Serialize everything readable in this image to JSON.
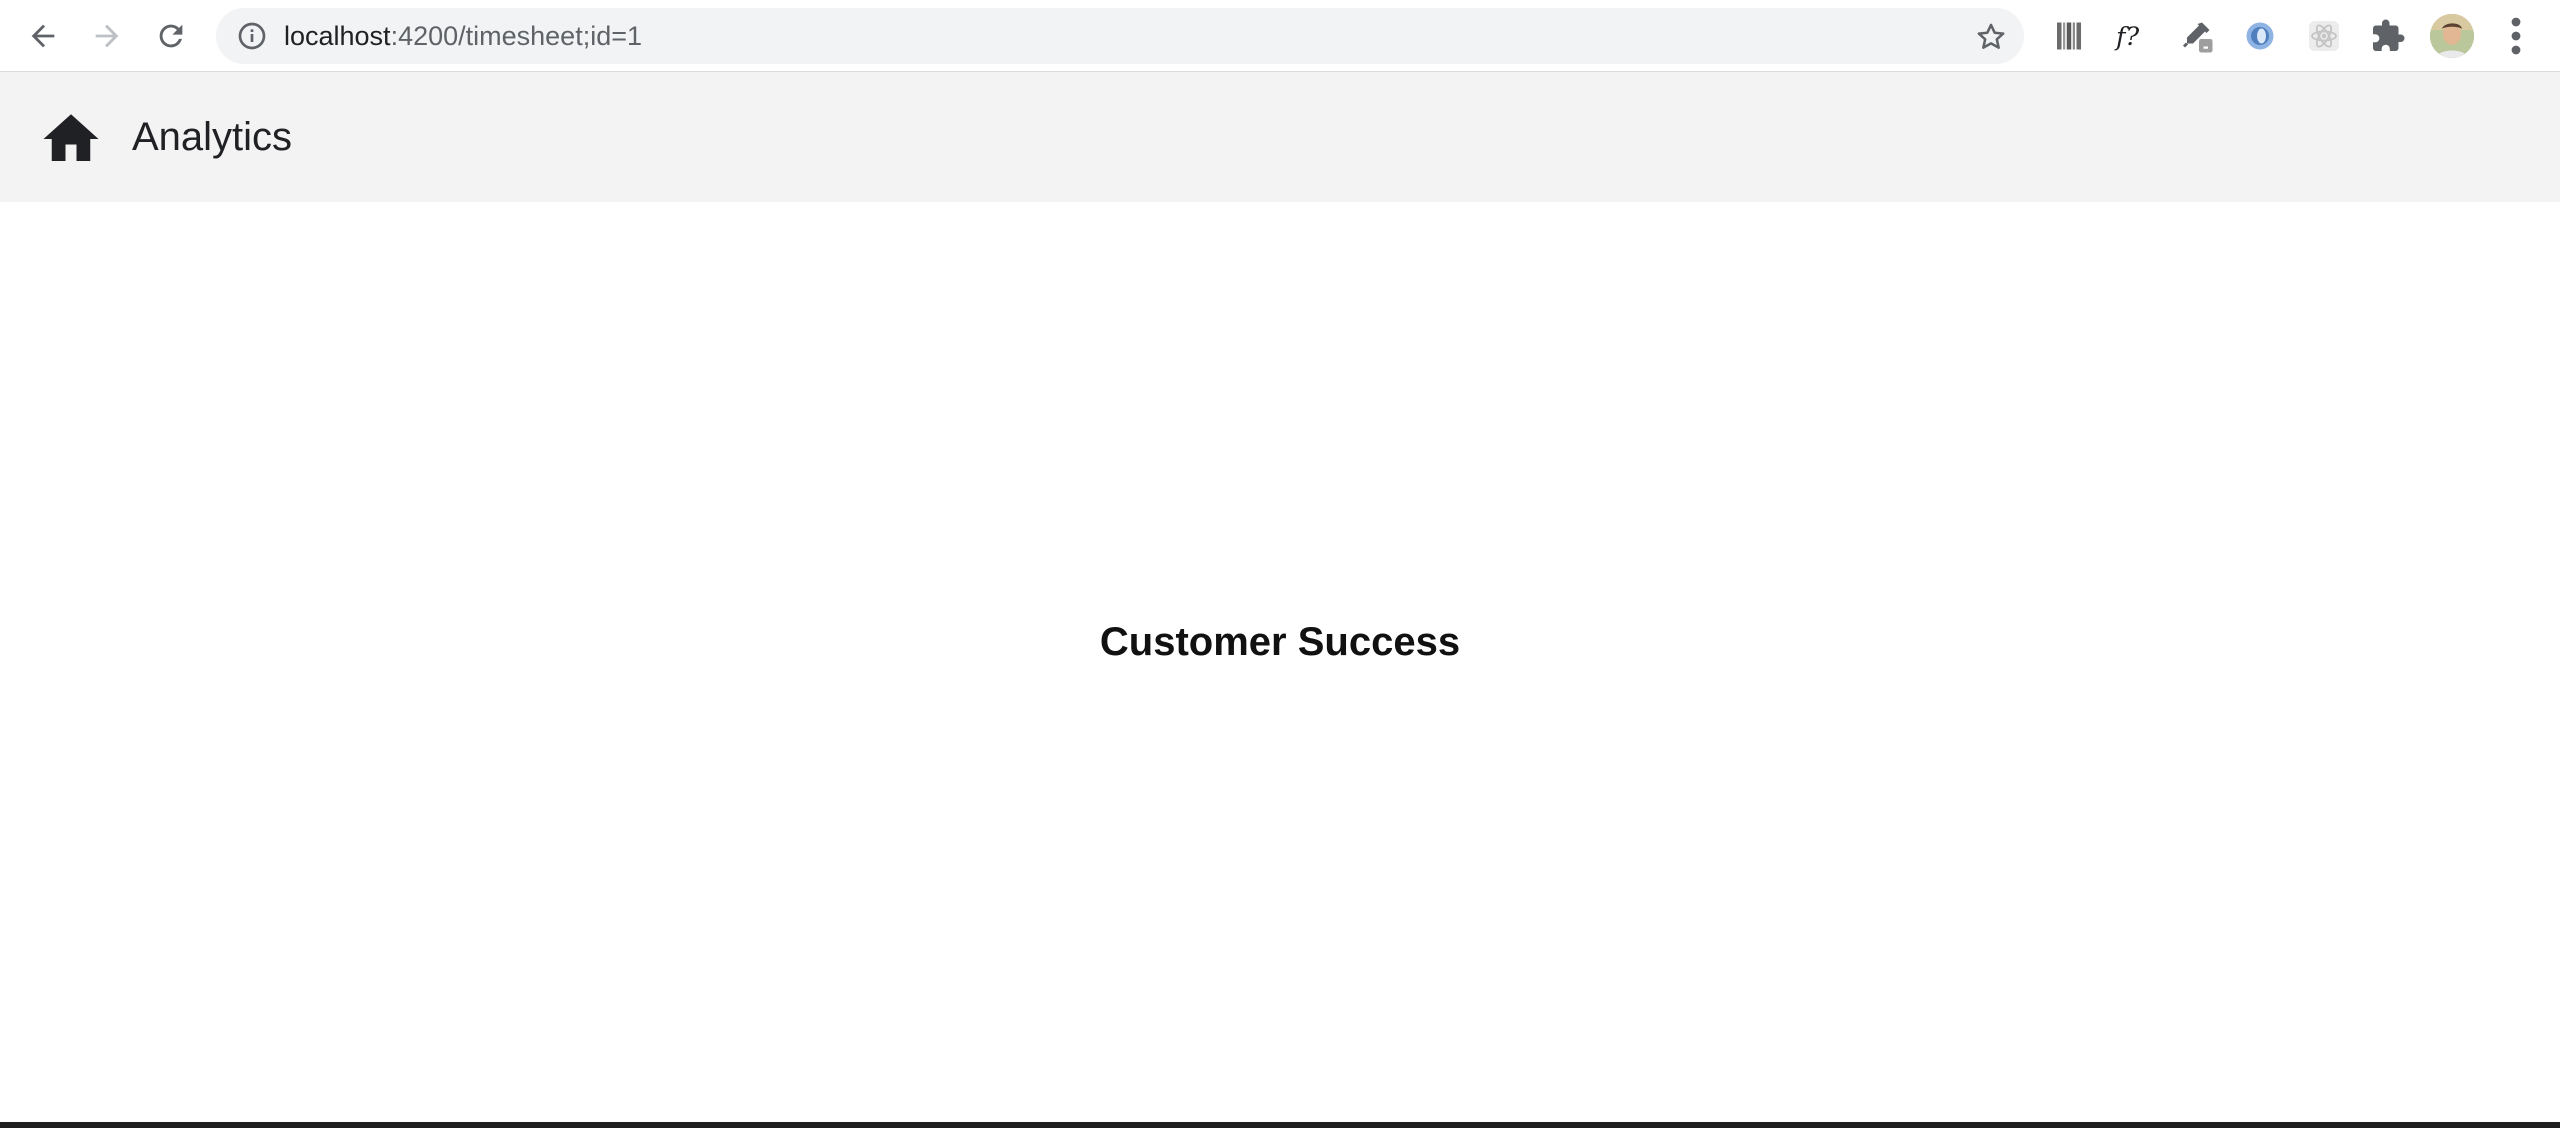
{
  "browser": {
    "url_host": "localhost",
    "url_path": ":4200/timesheet;id=1",
    "extensions": [
      "barcode-extension-icon",
      "font-finder-extension-icon",
      "eyedropper-extension-icon",
      "browser-extension-icon",
      "react-devtools-icon",
      "puzzle-icon"
    ]
  },
  "app": {
    "title": "Analytics"
  },
  "main": {
    "heading": "Customer Success"
  }
}
